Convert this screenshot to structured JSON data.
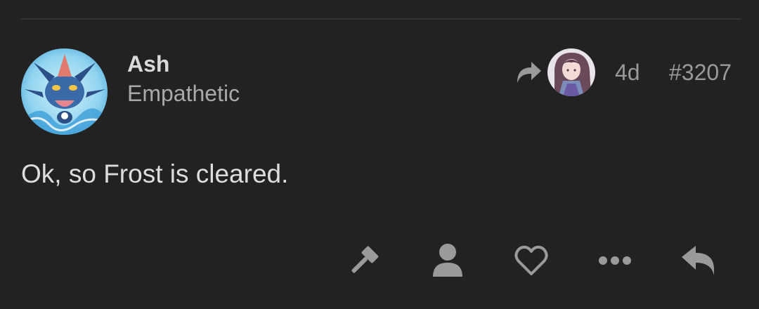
{
  "post": {
    "author": {
      "username": "Ash",
      "title": "Empathetic",
      "avatar_icon": "greninja-avatar"
    },
    "reply_to_avatar_icon": "anime-girl-avatar",
    "age": "4d",
    "post_number": "#3207",
    "content": "Ok, so Frost is cleared."
  },
  "actions": {
    "flag_icon": "gavel-icon",
    "user_icon": "user-icon",
    "like_icon": "heart-icon",
    "more_icon": "ellipsis-icon",
    "reply_icon": "reply-icon"
  },
  "colors": {
    "background": "#222222",
    "icon": "#9a9a9a",
    "text_primary": "#dddddd",
    "text_muted": "#999999"
  }
}
